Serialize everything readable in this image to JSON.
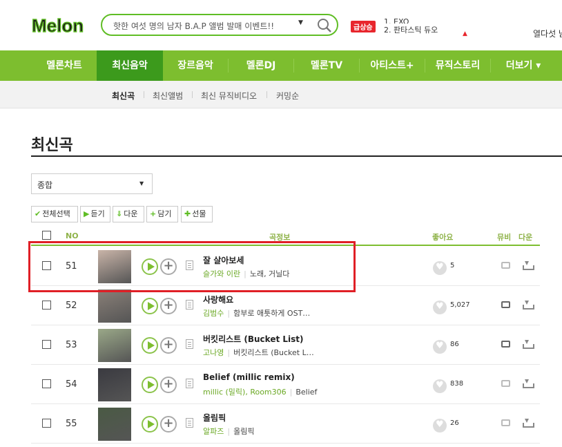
{
  "header": {
    "logo_text": "Melon",
    "search_text": "핫한 여섯 명의 남자 B.A.P 앨범 발매 이벤트!!",
    "rise_badge": "급상승",
    "rise_ranks": [
      "1. EXO",
      "2. 판타스틱 듀오"
    ],
    "right_cut_text": "열다섯 남"
  },
  "gnb": {
    "items": [
      "멜론차트",
      "최신음악",
      "장르음악",
      "멜론DJ",
      "멜론TV",
      "아티스트+",
      "뮤직스토리",
      "더보기 ▾"
    ],
    "active_index": 1
  },
  "subnav": {
    "items": [
      "최신곡",
      "최신앨범",
      "최신 뮤직비디오",
      "커밍순"
    ],
    "active_index": 0
  },
  "page": {
    "title": "최신곡",
    "filter_value": "종합"
  },
  "actions": {
    "select_all": "전체선택",
    "listen": "듣기",
    "download": "다운",
    "add": "담기",
    "gift": "선물"
  },
  "table": {
    "headers": {
      "no": "NO",
      "song": "곡정보",
      "like": "좋아요",
      "mv": "뮤비",
      "down": "다운"
    },
    "rows": [
      {
        "rank": "51",
        "title": "잘 살아보세",
        "artists": [
          "슬가와 이란"
        ],
        "album": "노래, 거닐다",
        "likes": "5",
        "mv": false,
        "cover_color": "#c9b4a8"
      },
      {
        "rank": "52",
        "title": "사랑해요",
        "artists": [
          "김범수"
        ],
        "album": "함부로 애틋하게 OST…",
        "likes": "5,027",
        "mv": true,
        "cover_color": "#8a8078"
      },
      {
        "rank": "53",
        "title": "버킷리스트 (Bucket List)",
        "artists": [
          "고나영"
        ],
        "album": "버킷리스트 (Bucket L…",
        "likes": "86",
        "mv": true,
        "cover_color": "#9aa888"
      },
      {
        "rank": "54",
        "title": "Belief (millic remix)",
        "artists": [
          "millic (밀릭)",
          "Room306"
        ],
        "album": "Belief",
        "likes": "838",
        "mv": false,
        "cover_color": "#3a3a40"
      },
      {
        "rank": "55",
        "title": "올림픽",
        "artists": [
          "알파즈"
        ],
        "album": "올림픽",
        "likes": "26",
        "mv": false,
        "cover_color": "#4a5a44"
      }
    ]
  },
  "colors": {
    "brand": "#7dbe2f",
    "brand_dark": "#3c9a1c",
    "highlight": "#e01f26"
  }
}
